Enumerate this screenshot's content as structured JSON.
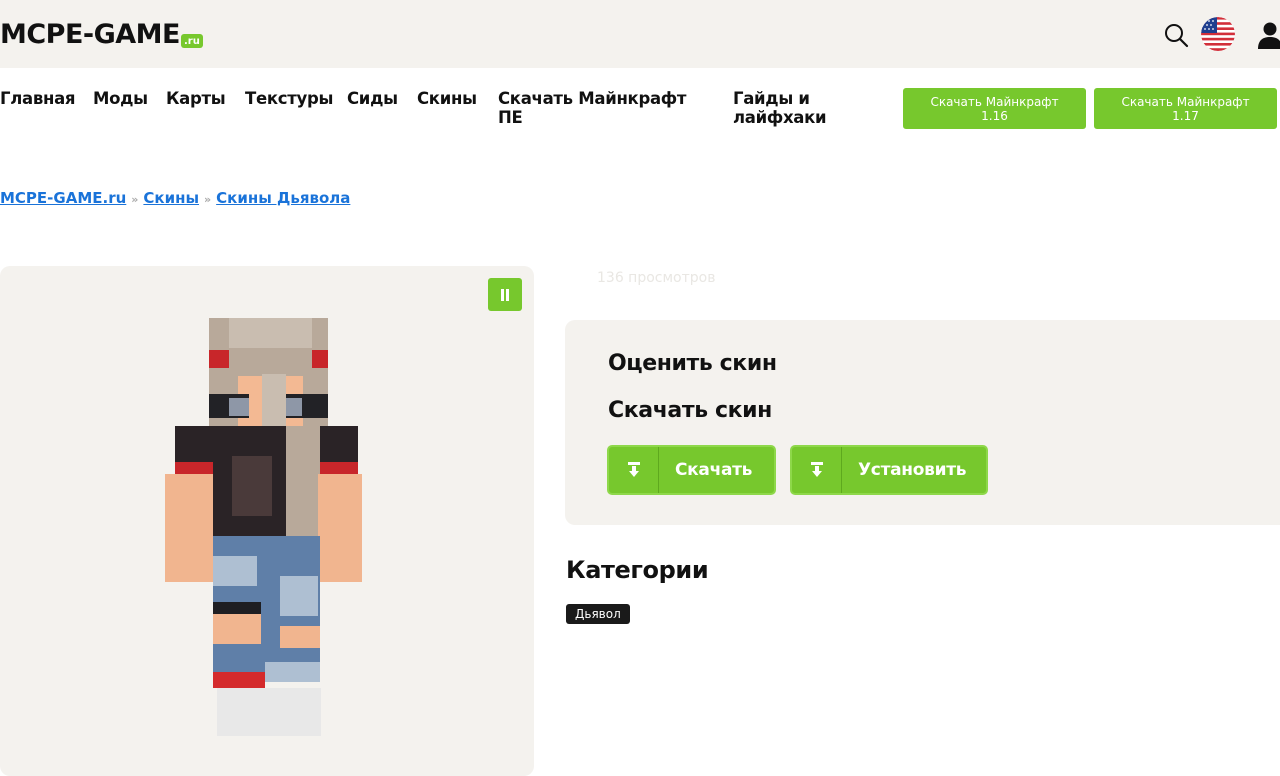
{
  "header": {
    "logo_text": "MCPE-GAME",
    "logo_suffix": ".ru",
    "icons": [
      "search-icon",
      "us-flag-icon",
      "user-icon"
    ]
  },
  "nav": {
    "items": [
      "Главная",
      "Моды",
      "Карты",
      "Текстуры",
      "Сиды",
      "Скины"
    ],
    "item_download_line1": "Скачать Майнкрафт",
    "item_download_line2": "ПЕ",
    "item_guides_line1": "Гайды и",
    "item_guides_line2": "лайфхаки",
    "btn1_line1": "Скачать Майнкрафт",
    "btn1_line2": "1.16",
    "btn2_line1": "Скачать Майнкрафт",
    "btn2_line2": "1.17"
  },
  "breadcrumb": {
    "items": [
      "MCPE-GAME.ru",
      "Скины",
      "Скины Дьявола"
    ],
    "separator": "»"
  },
  "skin": {
    "views": "136 просмотров"
  },
  "actions": {
    "rate_title": "Оценить скин",
    "download_title": "Скачать скин",
    "download_label": "Скачать",
    "install_label": "Установить"
  },
  "categories": {
    "title": "Категории",
    "tags": [
      "Дьявол"
    ]
  },
  "colors": {
    "accent": "#77c82d",
    "panel": "#f4f2ee",
    "link": "#1a73d9"
  }
}
